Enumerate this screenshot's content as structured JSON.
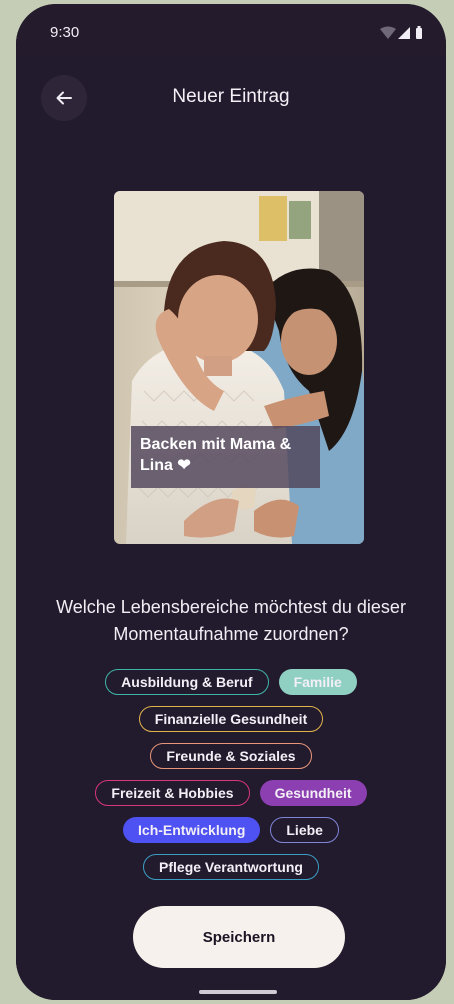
{
  "status_bar": {
    "time": "9:30",
    "icons": [
      "wifi-icon",
      "cellular-signal-icon",
      "battery-icon"
    ]
  },
  "header": {
    "back_icon": "arrow-left-icon",
    "title": "Neuer Eintrag"
  },
  "photo": {
    "caption": "Backen mit Mama & Lina ❤"
  },
  "question": "Welche Lebensbereiche möchtest du dieser Momentaufnahme zuordnen?",
  "chip_rows": [
    [
      {
        "label": "Ausbildung & Beruf",
        "selected": false,
        "color": "#3fb5a6"
      },
      {
        "label": "Familie",
        "selected": true,
        "color": "#8fd0c2"
      }
    ],
    [
      {
        "label": "Finanzielle Gesundheit",
        "selected": false,
        "color": "#e2b34c"
      }
    ],
    [
      {
        "label": "Freunde & Soziales",
        "selected": false,
        "color": "#e8957a"
      }
    ],
    [
      {
        "label": "Freizeit & Hobbies",
        "selected": false,
        "color": "#d6377a"
      },
      {
        "label": "Gesundheit",
        "selected": true,
        "color": "#8c3fb0"
      }
    ],
    [
      {
        "label": "Ich-Entwicklung",
        "selected": true,
        "color": "#4e52f2"
      },
      {
        "label": "Liebe",
        "selected": false,
        "color": "#7f86d8"
      }
    ],
    [
      {
        "label": "Pflege Verantwortung",
        "selected": false,
        "color": "#3a9fc2"
      }
    ]
  ],
  "save_button": {
    "label": "Speichern"
  },
  "colors": {
    "background": "#221a2d",
    "status_bar": "#241c2c",
    "save_button": "#f6f1ec"
  }
}
